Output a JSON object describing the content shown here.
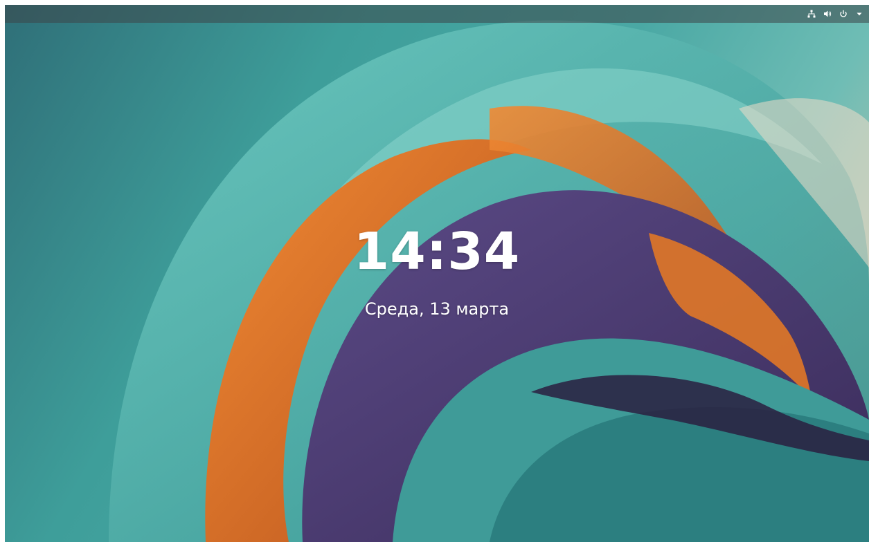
{
  "lockscreen": {
    "time": "14:34",
    "date": "Среда, 13 марта"
  },
  "topbar": {
    "icons": [
      "network-icon",
      "volume-icon",
      "power-icon",
      "menu-arrow-icon"
    ]
  },
  "colors": {
    "text": "#ffffff",
    "topbar": "#3c4648",
    "teal": "#4aa8a4",
    "orange": "#d9742a",
    "purple": "#4b3a6e"
  }
}
